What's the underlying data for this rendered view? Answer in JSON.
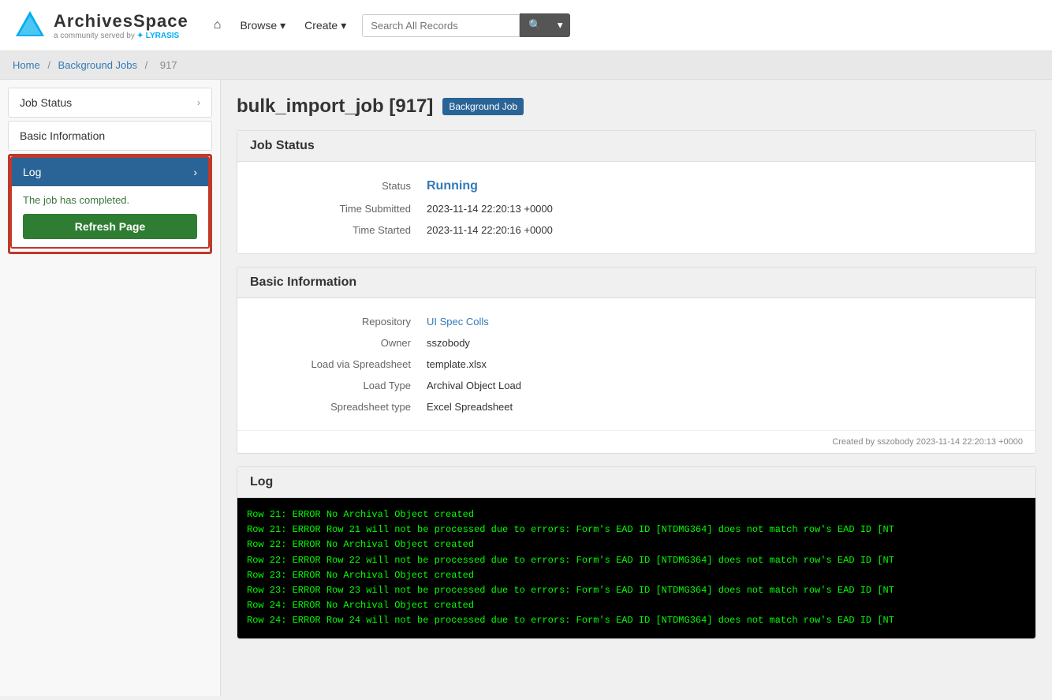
{
  "header": {
    "home_icon": "⌂",
    "browse_label": "Browse",
    "create_label": "Create",
    "search_placeholder": "Search All Records"
  },
  "breadcrumb": {
    "home": "Home",
    "background_jobs": "Background Jobs",
    "job_id": "917"
  },
  "sidebar": {
    "job_status_label": "Job Status",
    "basic_info_label": "Basic Information",
    "log_label": "Log",
    "log_completed_msg": "The job has completed.",
    "refresh_btn_label": "Refresh Page"
  },
  "page": {
    "title": "bulk_import_job [917]",
    "badge": "Background Job",
    "job_status_section": "Job Status",
    "status_label": "Status",
    "status_value": "Running",
    "time_submitted_label": "Time Submitted",
    "time_submitted_value": "2023-11-14 22:20:13 +0000",
    "time_started_label": "Time Started",
    "time_started_value": "2023-11-14 22:20:16 +0000",
    "basic_info_section": "Basic Information",
    "repository_label": "Repository",
    "repository_value": "UI Spec Colls",
    "owner_label": "Owner",
    "owner_value": "sszobody",
    "load_via_label": "Load via Spreadsheet",
    "load_via_value": "template.xlsx",
    "load_type_label": "Load Type",
    "load_type_value": "Archival Object Load",
    "spreadsheet_type_label": "Spreadsheet type",
    "spreadsheet_type_value": "Excel Spreadsheet",
    "created_by": "Created by sszobody 2023-11-14 22:20:13 +0000",
    "log_section": "Log",
    "log_lines": [
      "Row 21: ERROR No Archival Object created",
      "Row 21: ERROR Row 21 will not be processed due to errors: Form's EAD ID [NTDMG364] does not match row's EAD ID [NT",
      "Row 22: ERROR No Archival Object created",
      "Row 22: ERROR Row 22 will not be processed due to errors: Form's EAD ID [NTDMG364] does not match row's EAD ID [NT",
      "Row 23: ERROR No Archival Object created",
      "Row 23: ERROR Row 23 will not be processed due to errors: Form's EAD ID [NTDMG364] does not match row's EAD ID [NT",
      "Row 24: ERROR No Archival Object created",
      "Row 24: ERROR Row 24 will not be processed due to errors: Form's EAD ID [NTDMG364] does not match row's EAD ID [NT"
    ]
  }
}
